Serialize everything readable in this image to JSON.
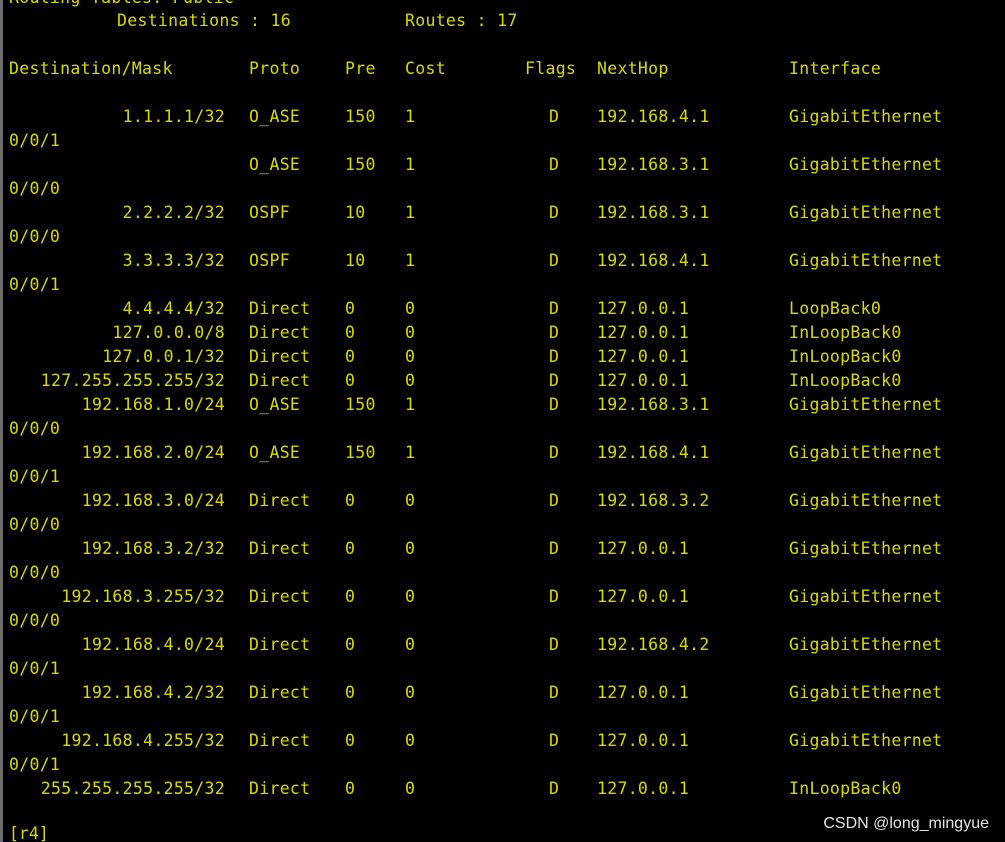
{
  "header": {
    "table_title": "Routing Tables: Public",
    "destinations_label": "Destinations : 16",
    "routes_label": "Routes : 17"
  },
  "columns": {
    "destination": "Destination/Mask",
    "proto": "Proto",
    "pre": "Pre",
    "cost": "Cost",
    "flags": "Flags",
    "nexthop": "NextHop",
    "interface": "Interface"
  },
  "routes": [
    {
      "dest": "1.1.1.1/32",
      "proto": "O_ASE",
      "pre": "150",
      "cost": "1",
      "flags": "D",
      "nexthop": "192.168.4.1",
      "iface": "GigabitEthernet",
      "iface_cont": "0/0/1"
    },
    {
      "dest": "",
      "proto": "O_ASE",
      "pre": "150",
      "cost": "1",
      "flags": "D",
      "nexthop": "192.168.3.1",
      "iface": "GigabitEthernet",
      "iface_cont": "0/0/0"
    },
    {
      "dest": "2.2.2.2/32",
      "proto": "OSPF",
      "pre": "10",
      "cost": "1",
      "flags": "D",
      "nexthop": "192.168.3.1",
      "iface": "GigabitEthernet",
      "iface_cont": "0/0/0"
    },
    {
      "dest": "3.3.3.3/32",
      "proto": "OSPF",
      "pre": "10",
      "cost": "1",
      "flags": "D",
      "nexthop": "192.168.4.1",
      "iface": "GigabitEthernet",
      "iface_cont": "0/0/1"
    },
    {
      "dest": "4.4.4.4/32",
      "proto": "Direct",
      "pre": "0",
      "cost": "0",
      "flags": "D",
      "nexthop": "127.0.0.1",
      "iface": "LoopBack0",
      "iface_cont": ""
    },
    {
      "dest": "127.0.0.0/8",
      "proto": "Direct",
      "pre": "0",
      "cost": "0",
      "flags": "D",
      "nexthop": "127.0.0.1",
      "iface": "InLoopBack0",
      "iface_cont": ""
    },
    {
      "dest": "127.0.0.1/32",
      "proto": "Direct",
      "pre": "0",
      "cost": "0",
      "flags": "D",
      "nexthop": "127.0.0.1",
      "iface": "InLoopBack0",
      "iface_cont": ""
    },
    {
      "dest": "127.255.255.255/32",
      "proto": "Direct",
      "pre": "0",
      "cost": "0",
      "flags": "D",
      "nexthop": "127.0.0.1",
      "iface": "InLoopBack0",
      "iface_cont": ""
    },
    {
      "dest": "192.168.1.0/24",
      "proto": "O_ASE",
      "pre": "150",
      "cost": "1",
      "flags": "D",
      "nexthop": "192.168.3.1",
      "iface": "GigabitEthernet",
      "iface_cont": "0/0/0"
    },
    {
      "dest": "192.168.2.0/24",
      "proto": "O_ASE",
      "pre": "150",
      "cost": "1",
      "flags": "D",
      "nexthop": "192.168.4.1",
      "iface": "GigabitEthernet",
      "iface_cont": "0/0/1"
    },
    {
      "dest": "192.168.3.0/24",
      "proto": "Direct",
      "pre": "0",
      "cost": "0",
      "flags": "D",
      "nexthop": "192.168.3.2",
      "iface": "GigabitEthernet",
      "iface_cont": "0/0/0"
    },
    {
      "dest": "192.168.3.2/32",
      "proto": "Direct",
      "pre": "0",
      "cost": "0",
      "flags": "D",
      "nexthop": "127.0.0.1",
      "iface": "GigabitEthernet",
      "iface_cont": "0/0/0"
    },
    {
      "dest": "192.168.3.255/32",
      "proto": "Direct",
      "pre": "0",
      "cost": "0",
      "flags": "D",
      "nexthop": "127.0.0.1",
      "iface": "GigabitEthernet",
      "iface_cont": "0/0/0"
    },
    {
      "dest": "192.168.4.0/24",
      "proto": "Direct",
      "pre": "0",
      "cost": "0",
      "flags": "D",
      "nexthop": "192.168.4.2",
      "iface": "GigabitEthernet",
      "iface_cont": "0/0/1"
    },
    {
      "dest": "192.168.4.2/32",
      "proto": "Direct",
      "pre": "0",
      "cost": "0",
      "flags": "D",
      "nexthop": "127.0.0.1",
      "iface": "GigabitEthernet",
      "iface_cont": "0/0/1"
    },
    {
      "dest": "192.168.4.255/32",
      "proto": "Direct",
      "pre": "0",
      "cost": "0",
      "flags": "D",
      "nexthop": "127.0.0.1",
      "iface": "GigabitEthernet",
      "iface_cont": "0/0/1"
    },
    {
      "dest": "255.255.255.255/32",
      "proto": "Direct",
      "pre": "0",
      "cost": "0",
      "flags": "D",
      "nexthop": "127.0.0.1",
      "iface": "InLoopBack0",
      "iface_cont": ""
    }
  ],
  "prompt": "[r4]",
  "watermark": "CSDN @long_mingyue",
  "colors": {
    "background": "#000000",
    "text": "#d9d900",
    "watermark": "#e6e6e6",
    "border": "#6e6e6e"
  }
}
